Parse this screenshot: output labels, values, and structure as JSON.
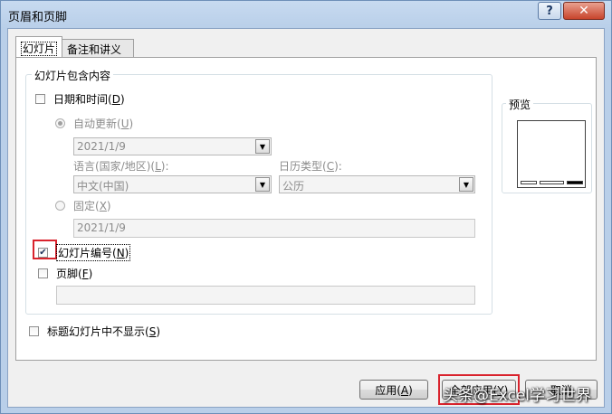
{
  "window": {
    "title": "页眉和页脚",
    "help": "?",
    "close": "✕"
  },
  "tabs": [
    {
      "label": "幻灯片",
      "active": true
    },
    {
      "label": "备注和讲义",
      "active": false
    }
  ],
  "slide_group": {
    "legend": "幻灯片包含内容",
    "datetime": {
      "label": "日期和时间(",
      "key": "D",
      "close": ")",
      "checked": false
    },
    "auto_update": {
      "label": "自动更新(",
      "key": "U",
      "close": ")",
      "selected": true,
      "value": "2021/1/9"
    },
    "language": {
      "label": "语言(国家/地区)(",
      "key": "L",
      "close": "):",
      "value": "中文(中国)"
    },
    "calendar": {
      "label": "日历类型(",
      "key": "C",
      "close": "):",
      "value": "公历"
    },
    "fixed": {
      "label": "固定(",
      "key": "X",
      "close": ")",
      "selected": false,
      "value": "2021/1/9"
    },
    "slide_number": {
      "label": "幻灯片编号(",
      "key": "N",
      "close": ")",
      "checked": true,
      "mark": "✔"
    },
    "footer": {
      "label": "页脚(",
      "key": "F",
      "close": ")",
      "checked": false,
      "value": ""
    }
  },
  "preview": {
    "legend": "预览"
  },
  "title_slide": {
    "label": "标题幻灯片中不显示(",
    "key": "S",
    "close": ")",
    "checked": false
  },
  "buttons": {
    "apply": {
      "label": "应用(",
      "key": "A",
      "close": ")"
    },
    "apply_all": {
      "label": "全部应用(",
      "key": "Y",
      "close": ")"
    },
    "cancel": {
      "label": "取消"
    }
  },
  "watermark": "头条@Excel学习世界"
}
